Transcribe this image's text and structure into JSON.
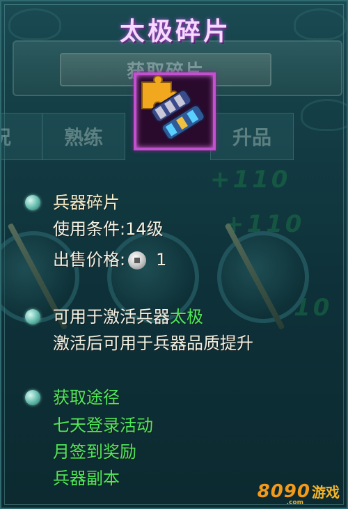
{
  "tooltip": {
    "title": "太极碎片",
    "item_icon": "weapon-fragment-icon",
    "section1": {
      "name": "兵器碎片",
      "requirement": "使用条件:14级",
      "price_label": "出售价格:",
      "price_currency_icon": "silver-coin-icon",
      "price_value": "1"
    },
    "section2": {
      "activate_prefix": "可用于激活兵器",
      "activate_weapon": "太极",
      "after_activate": "激活后可用于兵器品质提升"
    },
    "section3": {
      "header": "获取途径",
      "sources": [
        "七天登录活动",
        "月签到奖励",
        "兵器副本"
      ]
    }
  },
  "background": {
    "get_fragment_button": "获取碎片",
    "tabs": [
      "况",
      "熟练",
      "升品"
    ]
  },
  "watermark": {
    "brand_number": "8090",
    "brand_text": "游戏",
    "brand_suffix": ".com"
  },
  "colors": {
    "title": "#f7d8ff",
    "highlight_green": "#4ee85a",
    "icon_border": "#c44fd0"
  }
}
